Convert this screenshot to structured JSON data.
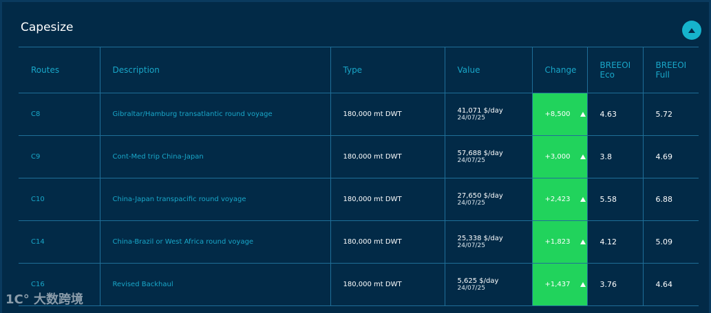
{
  "panel": {
    "title": "Capesize",
    "collapse_icon": "triangle-up-icon"
  },
  "table": {
    "headers": [
      "Routes",
      "Description",
      "Type",
      "Value",
      "Change",
      "BREEOI Eco",
      "BREEOI Full"
    ],
    "rows": [
      {
        "route": "C8",
        "description": "Gibraltar/Hamburg transatlantic round voyage",
        "type": "180,000 mt DWT",
        "value": "41,071 $/day",
        "date": "24/07/25",
        "change": "+8,500",
        "eco": "4.63",
        "full": "5.72"
      },
      {
        "route": "C9",
        "description": "Cont-Med trip China-Japan",
        "type": "180,000 mt DWT",
        "value": "57,688 $/day",
        "date": "24/07/25",
        "change": "+3,000",
        "eco": "3.8",
        "full": "4.69"
      },
      {
        "route": "C10",
        "description": "China-Japan transpacific round voyage",
        "type": "180,000 mt DWT",
        "value": "27,650 $/day",
        "date": "24/07/25",
        "change": "+2,423",
        "eco": "5.58",
        "full": "6.88"
      },
      {
        "route": "C14",
        "description": "China-Brazil or West Africa round voyage",
        "type": "180,000 mt DWT",
        "value": "25,338 $/day",
        "date": "24/07/25",
        "change": "+1,823",
        "eco": "4.12",
        "full": "5.09"
      },
      {
        "route": "C16",
        "description": "Revised Backhaul",
        "type": "180,000 mt DWT",
        "value": "5,625 $/day",
        "date": "24/07/25",
        "change": "+1,437",
        "eco": "3.76",
        "full": "4.64"
      }
    ]
  },
  "colors": {
    "positive_change": "#21d35c",
    "accent": "#19a7c9",
    "background": "#022a47"
  },
  "watermark": "1C大数跨境"
}
